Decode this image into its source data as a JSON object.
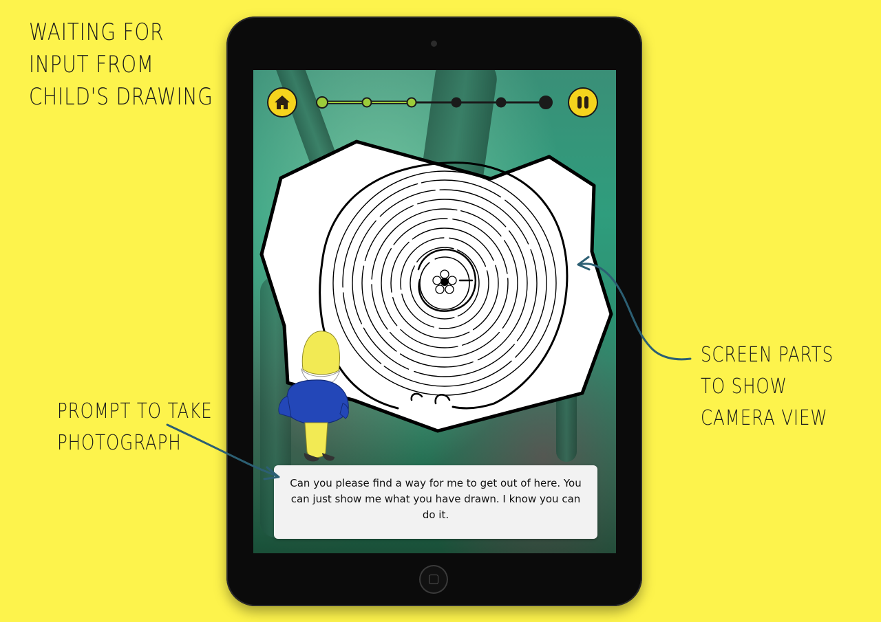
{
  "annotations": {
    "top_left": [
      "WAITING FOR",
      "INPUT FROM",
      "CHILD'S DRAWING"
    ],
    "right": [
      "SCREEN PARTS",
      "TO SHOW",
      "CAMERA VIEW"
    ],
    "left": [
      "PROMPT TO TAKE",
      "PHOTOGRAPH"
    ]
  },
  "app": {
    "home_button_icon": "home-icon",
    "pause_button_icon": "pause-icon",
    "progress": {
      "total_steps": 6,
      "completed_steps": 3,
      "completed_color": "#9ccc3a",
      "pending_color": "#1a1a1a"
    },
    "prompt_text": "Can you please find a way for me to get out of here. You can just show me what you have drawn. I know you can do it."
  },
  "colors": {
    "background": "#fdf34c",
    "button_fill": "#f5d41d",
    "arrow": "#2c5f73"
  }
}
